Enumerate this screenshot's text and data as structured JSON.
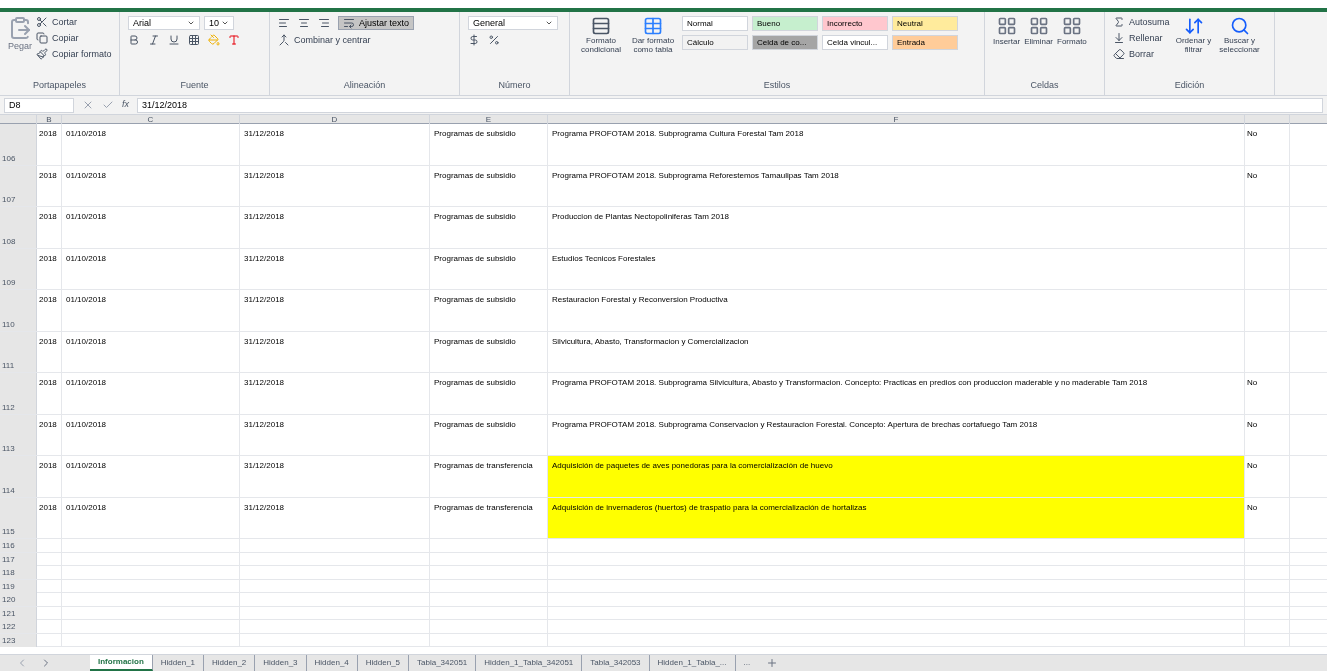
{
  "clipboard": {
    "label": "Portapapeles",
    "paste": "Pegar",
    "actions": [
      "Cortar",
      "Copiar",
      "Copiar formato"
    ]
  },
  "font": {
    "label": "Fuente",
    "name": "Arial",
    "size": "10"
  },
  "alignment": {
    "label": "Alineación",
    "wrap": {
      "label": "Ajustar texto",
      "selected": true
    },
    "merge": "Combinar y centrar"
  },
  "number": {
    "label": "Número",
    "format": "General"
  },
  "styles": {
    "label": "Estilos",
    "conditional": "Formato condicional",
    "as_table": "Dar formato como tabla",
    "cell_styles": [
      {
        "label": "Normal",
        "color": "#ffffff"
      },
      {
        "label": "Bueno",
        "color": "#c6efce"
      },
      {
        "label": "Incorrecto",
        "color": "#ffc7ce"
      },
      {
        "label": "Neutral",
        "color": "#ffeb9c"
      },
      {
        "label": "Cálculo",
        "color": "#f2f2f2"
      },
      {
        "label": "Celda de co...",
        "color": "#a5a5a5"
      },
      {
        "label": "Celda vincul...",
        "color": "#ffffff"
      },
      {
        "label": "Entrada",
        "color": "#ffcc99"
      }
    ]
  },
  "cells": {
    "label": "Celdas",
    "buttons": [
      "Insertar",
      "Eliminar",
      "Formato"
    ]
  },
  "editing": {
    "label": "Edición",
    "actions": [
      "Autosuma",
      "Rellenar",
      "Borrar"
    ],
    "sort": "Ordenar y filtrar",
    "find": "Buscar y seleccionar"
  },
  "formula_bar": {
    "name_box": "D8",
    "function_label": "fx",
    "value": "31/12/2018"
  },
  "columns": [
    "B",
    "C",
    "D",
    "E",
    "F"
  ],
  "rows": [
    {
      "number": "106",
      "col_b": "2018",
      "col_c": "01/10/2018",
      "col_d": "31/12/2018",
      "col_e": "Programas de subsidio",
      "col_f": "Programa PROFOTAM 2018. Subprograma Cultura Forestal Tam 2018",
      "col_g": "No",
      "highlighted": false
    },
    {
      "number": "107",
      "col_b": "2018",
      "col_c": "01/10/2018",
      "col_d": "31/12/2018",
      "col_e": "Programas de subsidio",
      "col_f": "Programa PROFOTAM 2018. Subprograma Reforestemos Tamaulipas Tam 2018",
      "col_g": "No",
      "highlighted": false
    },
    {
      "number": "108",
      "col_b": "2018",
      "col_c": "01/10/2018",
      "col_d": "31/12/2018",
      "col_e": "Programas de subsidio",
      "col_f": "Produccion de Plantas Nectopoliniferas Tam 2018",
      "col_g": "",
      "highlighted": false
    },
    {
      "number": "109",
      "col_b": "2018",
      "col_c": "01/10/2018",
      "col_d": "31/12/2018",
      "col_e": "Programas de subsidio",
      "col_f": "Estudios Tecnicos Forestales",
      "col_g": "",
      "highlighted": false
    },
    {
      "number": "110",
      "col_b": "2018",
      "col_c": "01/10/2018",
      "col_d": "31/12/2018",
      "col_e": "Programas de subsidio",
      "col_f": "Restauracion Forestal y Reconversion Productiva",
      "col_g": "",
      "highlighted": false
    },
    {
      "number": "111",
      "col_b": "2018",
      "col_c": "01/10/2018",
      "col_d": "31/12/2018",
      "col_e": "Programas de subsidio",
      "col_f": "Silvicultura, Abasto, Transformacion y Comercializacion",
      "col_g": "",
      "highlighted": false
    },
    {
      "number": "112",
      "col_b": "2018",
      "col_c": "01/10/2018",
      "col_d": "31/12/2018",
      "col_e": "Programas de subsidio",
      "col_f": "Programa PROFOTAM 2018. Subprograma Silvicultura, Abasto y Transformacion. Concepto: Practicas en predios con produccion maderable y no maderable Tam 2018",
      "col_g": "No",
      "highlighted": false
    },
    {
      "number": "113",
      "col_b": "2018",
      "col_c": "01/10/2018",
      "col_d": "31/12/2018",
      "col_e": "Programas de subsidio",
      "col_f": "Programa PROFOTAM 2018. Subprograma Conservacion y Restauracion Forestal. Concepto: Apertura de brechas cortafuego Tam 2018",
      "col_g": "No",
      "highlighted": false
    },
    {
      "number": "114",
      "col_b": "2018",
      "col_c": "01/10/2018",
      "col_d": "31/12/2018",
      "col_e": "Programas de transferencia",
      "col_f": "Adquisición de paquetes de aves ponedoras para la comercialización de huevo",
      "col_g": "No",
      "highlighted": true
    },
    {
      "number": "115",
      "col_b": "2018",
      "col_c": "01/10/2018",
      "col_d": "31/12/2018",
      "col_e": "Programas de transferencia",
      "col_f": "Adquisición de invernaderos (huertos) de traspatio para la comercialización de hortalizas",
      "col_g": "No",
      "highlighted": true
    }
  ],
  "empty_rows": [
    "116",
    "117",
    "118",
    "119",
    "120",
    "121",
    "122",
    "123"
  ],
  "sheet_tabs": [
    {
      "label": "Informacion",
      "selected": true
    },
    {
      "label": "Hidden_1",
      "selected": false
    },
    {
      "label": "Hidden_2",
      "selected": false
    },
    {
      "label": "Hidden_3",
      "selected": false
    },
    {
      "label": "Hidden_4",
      "selected": false
    },
    {
      "label": "Hidden_5",
      "selected": false
    },
    {
      "label": "Tabla_342051",
      "selected": false
    },
    {
      "label": "Hidden_1_Tabla_342051",
      "selected": false
    },
    {
      "label": "Tabla_342053",
      "selected": false
    },
    {
      "label": "Hidden_1_Tabla_...",
      "selected": false
    }
  ],
  "more_tabs": "..."
}
